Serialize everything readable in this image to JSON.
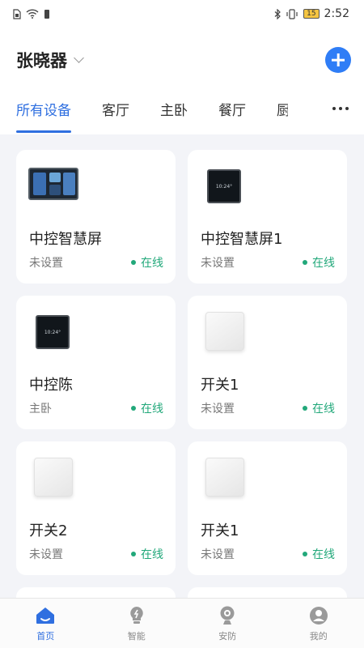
{
  "status_bar": {
    "battery_level": "15",
    "time": "2:52"
  },
  "header": {
    "home_name": "张晓器"
  },
  "tabs": [
    {
      "label": "所有设备",
      "active": true
    },
    {
      "label": "客厅",
      "active": false
    },
    {
      "label": "主卧",
      "active": false
    },
    {
      "label": "餐厅",
      "active": false
    },
    {
      "label": "厨",
      "active": false
    }
  ],
  "devices": [
    {
      "name": "中控智慧屏",
      "room": "未设置",
      "status": "在线",
      "image": "control-panel-wide"
    },
    {
      "name": "中控智慧屏1",
      "room": "未设置",
      "status": "在线",
      "image": "control-panel-square",
      "screen_text": "10:24°"
    },
    {
      "name": "中控陈",
      "room": "主卧",
      "status": "在线",
      "image": "control-panel-square",
      "screen_text": "10:24°"
    },
    {
      "name": "开关1",
      "room": "未设置",
      "status": "在线",
      "image": "wall-switch"
    },
    {
      "name": "开关2",
      "room": "未设置",
      "status": "在线",
      "image": "wall-switch"
    },
    {
      "name": "开关1",
      "room": "未设置",
      "status": "在线",
      "image": "wall-switch"
    }
  ],
  "bottom_nav": [
    {
      "label": "首页",
      "icon": "home-icon",
      "active": true
    },
    {
      "label": "智能",
      "icon": "smart-bulb-icon",
      "active": false
    },
    {
      "label": "安防",
      "icon": "camera-icon",
      "active": false
    },
    {
      "label": "我的",
      "icon": "profile-icon",
      "active": false
    }
  ],
  "colors": {
    "accent": "#2f6fe0",
    "online": "#22a87a",
    "background": "#f3f4f8"
  }
}
